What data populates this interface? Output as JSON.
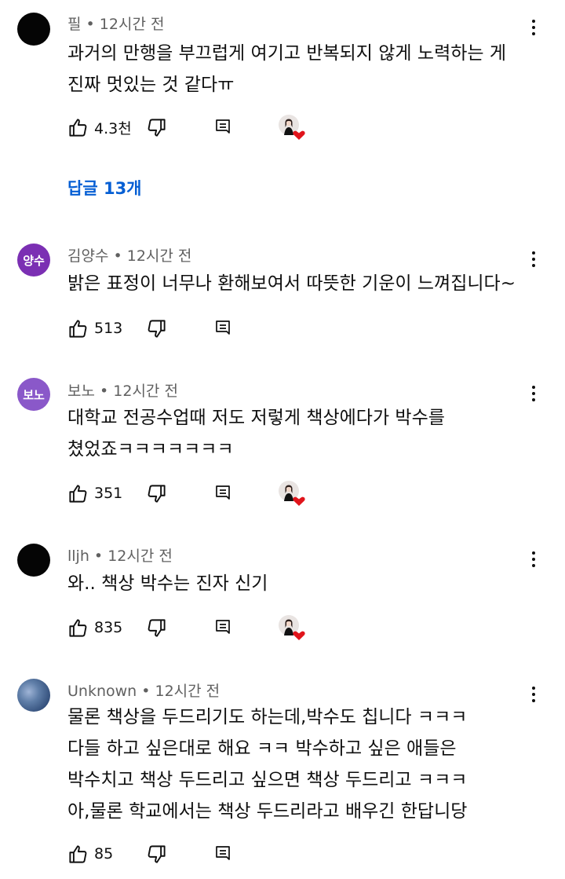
{
  "comments": [
    {
      "author": "필",
      "time": "12시간 전",
      "avatar_text": "",
      "lines": [
        "과거의 만행을 부끄럽게 여기고 반복되지 않게 노력하는 게",
        "진짜 멋있는 것 같다ㅠ"
      ],
      "likes": "4.3천",
      "creator_heart": true
    },
    {
      "author": "김양수",
      "time": "12시간 전",
      "avatar_text": "양수",
      "lines": [
        "밝은 표정이 너무나 환해보여서 따뜻한 기운이 느껴집니다~"
      ],
      "likes": "513",
      "creator_heart": false
    },
    {
      "author": "보노",
      "time": "12시간 전",
      "avatar_text": "보노",
      "lines": [
        "대학교 전공수업때 저도 저렇게 책상에다가 박수를",
        "쳤었죠ㅋㅋㅋㅋㅋㅋㅋ"
      ],
      "likes": "351",
      "creator_heart": true
    },
    {
      "author": "lljh",
      "time": "12시간 전",
      "avatar_text": "",
      "lines": [
        "와.. 책상 박수는 진자 신기"
      ],
      "likes": "835",
      "creator_heart": true
    },
    {
      "author": "Unknown",
      "time": "12시간 전",
      "avatar_text": "",
      "lines": [
        "물론 책상을 두드리기도 하는데,박수도 칩니다 ㅋㅋㅋ",
        "다들 하고 싶은대로 해요 ㅋㅋ 박수하고 싶은 애들은",
        "박수치고 책상 두드리고 싶으면 책상 두드리고 ㅋㅋㅋ",
        "아,물론 학교에서는 책상 두드리라고 배우긴 한답니당"
      ],
      "likes": "85",
      "creator_heart": false
    }
  ],
  "replies_link": "답글 13개",
  "separator": " • ",
  "colors": {
    "link": "#065fd4",
    "meta": "#606060",
    "heart": "#e0141b"
  },
  "icons": [
    "like-icon",
    "dislike-icon",
    "reply-icon",
    "more-vert-icon",
    "creator-heart-icon"
  ]
}
